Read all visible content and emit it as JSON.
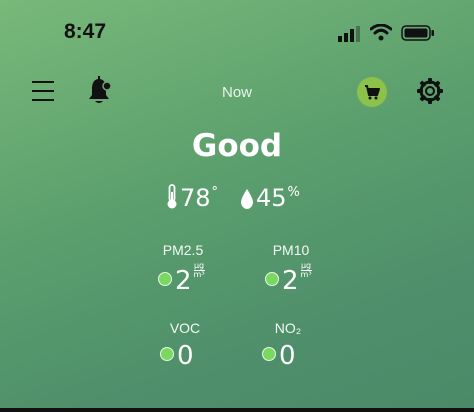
{
  "status_bar": {
    "time": "8:47"
  },
  "header": {
    "title": "Now"
  },
  "air": {
    "status": "Good",
    "temperature": "78",
    "temperature_unit": "°",
    "humidity": "45",
    "humidity_unit": "%"
  },
  "metrics": {
    "pm25": {
      "label": "PM2.5",
      "value": "2",
      "unit_top": "µg",
      "unit_bottom": "m³"
    },
    "pm10": {
      "label": "PM10",
      "value": "2",
      "unit_top": "µg",
      "unit_bottom": "m³"
    },
    "voc": {
      "label": "VOC",
      "value": "0"
    },
    "no2": {
      "label": "NO₂",
      "value": "0"
    }
  },
  "icons": {
    "menu": "menu-icon",
    "bell": "bell-icon",
    "cart": "cart-icon",
    "gear": "gear-icon",
    "thermometer": "thermometer-icon",
    "droplet": "droplet-icon"
  },
  "colors": {
    "background_top": "#78b879",
    "background_bottom": "#4a8a68",
    "status_dot": "#78d860",
    "cart_badge": "#8cc14a"
  }
}
